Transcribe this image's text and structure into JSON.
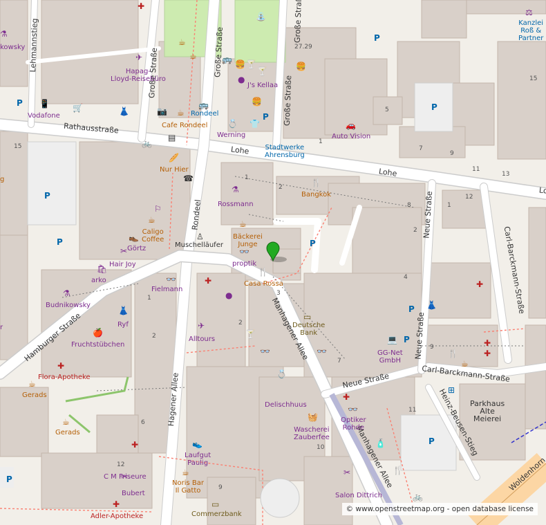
{
  "map": {
    "attribution": {
      "copyright": "©",
      "site": "www.openstreetmap.org",
      "separator": " - ",
      "license": "open database license"
    },
    "marker": {
      "color": "#22aa22"
    },
    "streets": {
      "lehmannstieg": "Lehmannstieg",
      "grosse_strasse_1": "Große Straße",
      "grosse_strasse_2": "Große Straße",
      "grosse_strasse_3": "Große Straße",
      "rathausstrasse": "Rathausstraße",
      "lohe_1": "Lohe",
      "lohe_2": "Lohe",
      "lohe_3": "Lo",
      "rondeel": "Rondeel",
      "hamburger_strasse": "Hamburger Straße",
      "hagener_allee": "Hagener Allee",
      "manhagener_allee_1": "Manhagener Allee",
      "manhagener_allee_2": "Manhagener Allee",
      "neue_strasse_1": "Neue Straße",
      "neue_strasse_2": "Neue Straße",
      "neue_strasse_3": "Neue Straße",
      "carl_barckmann_1": "Carl-Barckmann-Straße",
      "carl_barckmann_2": "Carl-Barckmann-Straße",
      "heinz_beusen": "Heinz-Beusen-Stieg",
      "woldenhorn": "Woldenhorn"
    },
    "pois": {
      "rossmann_top": "kowsky",
      "vodafone": "Vodafone",
      "hapag": "Hapag-\nLloyd-Reisebüro",
      "cafe_rondeel": "Cafe Rondeel",
      "rondeel_poi": "Rondeel",
      "werning": "Werning",
      "js_kellaa": "J's Kellaa",
      "stadtwerke": "Stadtwerke\nAhrensburg",
      "auto_vision": "Auto Vision",
      "kanzlei": "Kanzlei\nRoß &\nPartner",
      "nur_hier": "Nur Hier",
      "rossmann": "Rossmann",
      "bangkok": "Bangkok",
      "caligo": "Caligo\nCoffee",
      "baeckerei": "Bäckerei\nJunge",
      "muschellaeufer": "Muschelläufer",
      "goertz": "Görtz",
      "hair_joy": "Hair Joy",
      "arko": "arko",
      "proptik": "proptik",
      "casa_rossa": "Casa Rossa",
      "fielmann": "Fielmann",
      "budnikowsky": "Budnikowsky",
      "ryf": "Ryf",
      "deutsche_bank": "Deutsche\nBank",
      "fruchtstubchen": "Fruchtstübchen",
      "alltours": "Alltours",
      "gg_net": "GG-Net\nGmbH",
      "flora": "Flora-Apotheke",
      "gerads_1": "Gerads",
      "gerads_2": "Gerads",
      "delischhuus": "Delischhuus",
      "optiker": "Optiker\nRohde",
      "parkhaus": "Parkhaus\nAlte\nMeierei",
      "wascherei": "Wascherei\nZauberfee",
      "laufgut": "Laufgut\nPaulig",
      "cm_friseure": "C M Friseure",
      "noris": "Noris Bar\nIl Gatto",
      "bubert": "Bubert",
      "salon": "Salon Dittrich",
      "adler": "Adler-Apotheke",
      "commerzbank": "Commerzbank",
      "edge_r": "r",
      "edge_g": "g"
    },
    "housenumbers": {
      "h2729": "27.29",
      "h15a": "15",
      "h15b": "15",
      "h5": "5",
      "h1a": "1",
      "h7": "7",
      "h9": "9",
      "h11a": "11",
      "h13": "13",
      "h1b": "1",
      "h2a": "2",
      "h8": "8",
      "h1c": "1",
      "h12a": "12",
      "h2b": "2",
      "h4": "4",
      "h3": "3",
      "h1d": "1",
      "h2c": "2",
      "h7b": "7",
      "h9b": "9",
      "h2d": "2",
      "h6": "6",
      "h11b": "11",
      "h10": "10",
      "h12b": "12",
      "h9c": "9"
    }
  }
}
